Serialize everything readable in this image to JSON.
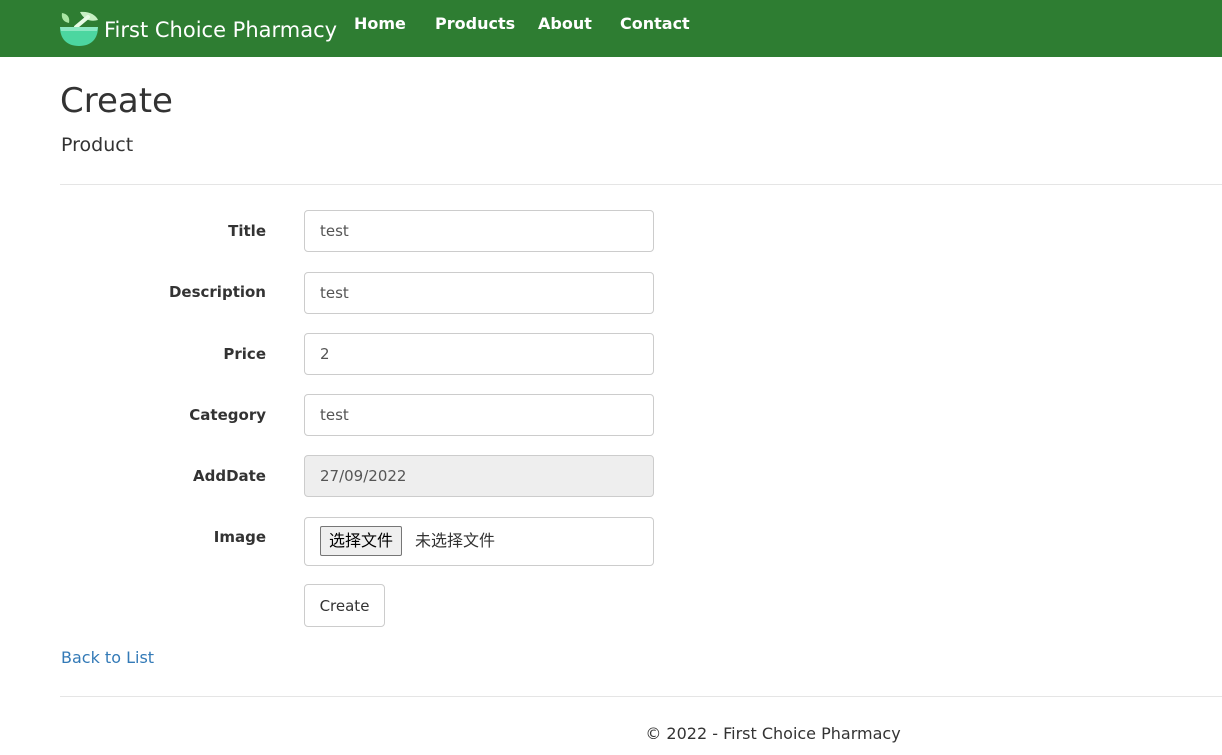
{
  "navbar": {
    "brand": "First Choice Pharmacy",
    "brand_icon": "leaf-bowl-icon",
    "links": [
      "Home",
      "Products",
      "About",
      "Contact"
    ],
    "color": "#2e7d32"
  },
  "page": {
    "title": "Create",
    "subtitle": "Product"
  },
  "form": {
    "fields": [
      {
        "label": "Title",
        "value": "test"
      },
      {
        "label": "Description",
        "value": "test"
      },
      {
        "label": "Price",
        "value": "2"
      },
      {
        "label": "Category",
        "value": "test"
      },
      {
        "label": "AddDate",
        "value": "27/09/2022"
      }
    ],
    "image": {
      "label": "Image",
      "button": "选择文件",
      "status": "未选择文件"
    },
    "submit": "Create"
  },
  "back_link": "Back to List",
  "footer": "© 2022 - First Choice Pharmacy",
  "colors": {
    "link": "#337ab7",
    "readonly_bg": "#eeeeee"
  }
}
